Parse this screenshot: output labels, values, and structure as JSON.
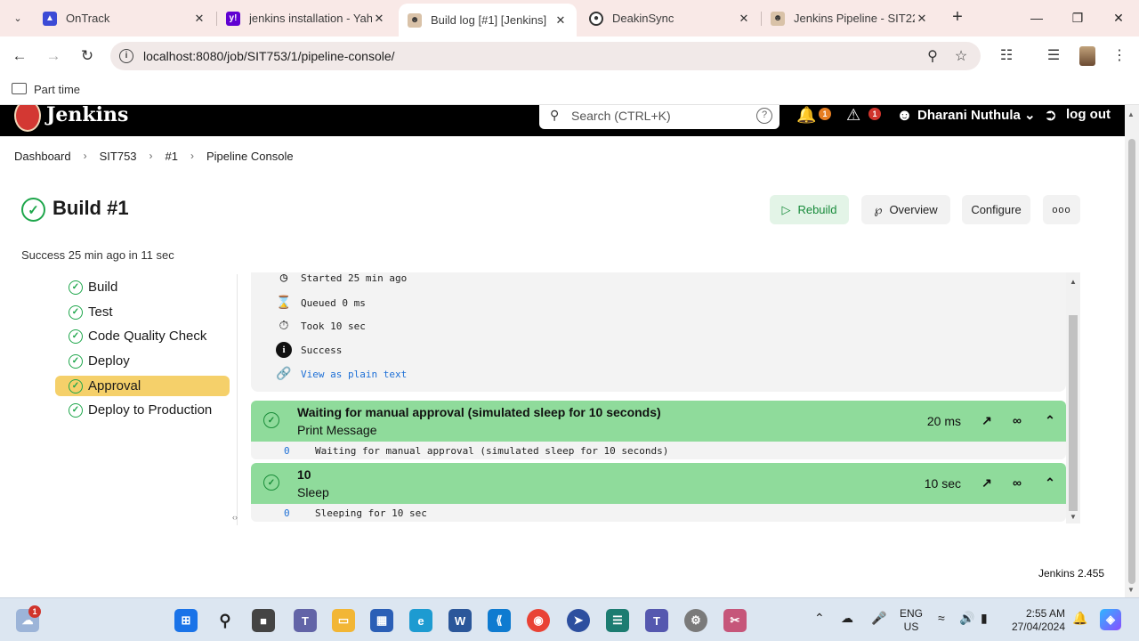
{
  "browser": {
    "tabs": [
      {
        "title": "OnTrack",
        "icon": "ontrack-icon"
      },
      {
        "title": "jenkins installation - Yahoo",
        "icon": "yahoo-icon"
      },
      {
        "title": "Build log [#1] [Jenkins]",
        "icon": "jenkins-icon",
        "active": true
      },
      {
        "title": "DeakinSync",
        "icon": "deakinsync-icon"
      },
      {
        "title": "Jenkins Pipeline - SIT223",
        "icon": "jenkins-icon"
      }
    ],
    "url": "localhost:8080/job/SIT753/1/pipeline-console/",
    "bookmark": "Part time"
  },
  "jenkins": {
    "brand": "Jenkins",
    "search_placeholder": "Search (CTRL+K)",
    "notifications_count": "1",
    "security_count": "1",
    "user": "Dharani Nuthula",
    "logout": "log out",
    "version": "Jenkins 2.455"
  },
  "breadcrumb": [
    "Dashboard",
    "SIT753",
    "#1",
    "Pipeline Console"
  ],
  "build": {
    "title": "Build #1",
    "subtitle": "Success 25 min ago in 11 sec",
    "actions": {
      "rebuild": "Rebuild",
      "overview": "Overview",
      "configure": "Configure",
      "more": "ooo"
    }
  },
  "stages": [
    "Build",
    "Test",
    "Code Quality Check",
    "Deploy",
    "Approval",
    "Deploy to Production"
  ],
  "active_stage": "Approval",
  "meta": {
    "started": "Started 25 min ago",
    "queued": "Queued 0 ms",
    "took": "Took 10 sec",
    "status": "Success",
    "plain_text": "View as plain text"
  },
  "steps": [
    {
      "title": "Waiting for manual approval (simulated sleep for 10 seconds)",
      "name": "Print Message",
      "duration": "20 ms",
      "log_num": "0",
      "log_text": "Waiting for manual approval (simulated sleep for 10 seconds)"
    },
    {
      "title": "10",
      "name": "Sleep",
      "duration": "10 sec",
      "log_num": "0",
      "log_text": "Sleeping for 10 sec"
    }
  ],
  "taskbar": {
    "notif": "1",
    "lang": "ENG",
    "region": "US",
    "time": "2:55 AM",
    "date": "27/04/2024"
  },
  "colors": {
    "success": "#1ea64b",
    "step_bg": "#8fdb9b",
    "active_stage": "#f5d06a",
    "link": "#1d6fd6"
  }
}
